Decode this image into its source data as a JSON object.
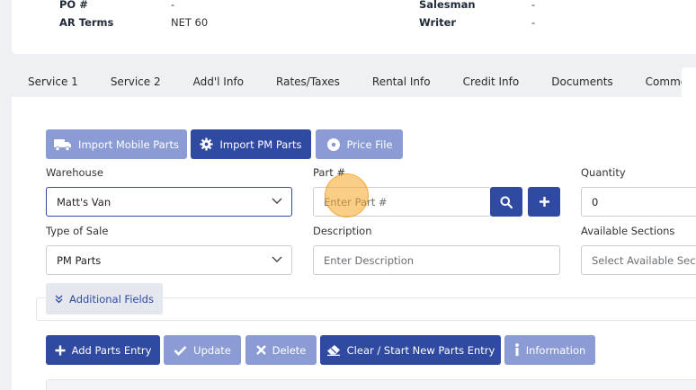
{
  "header": {
    "po_label": "PO #",
    "po_value": "-",
    "ar_terms_label": "AR Terms",
    "ar_terms_value": "NET 60",
    "salesman_label": "Salesman",
    "salesman_value": "-",
    "writer_label": "Writer",
    "writer_value": "-"
  },
  "tabs": [
    "Service 1",
    "Service 2",
    "Add'l Info",
    "Rates/Taxes",
    "Rental Info",
    "Credit Info",
    "Documents",
    "Comments"
  ],
  "import_buttons": {
    "mobile": "Import Mobile Parts",
    "pm": "Import PM Parts",
    "price_file": "Price File"
  },
  "form": {
    "warehouse_label": "Warehouse",
    "warehouse_value": "Matt's Van",
    "part_label": "Part #",
    "part_placeholder": "Enter Part #",
    "quantity_label": "Quantity",
    "quantity_value": "0",
    "type_of_sale_label": "Type of Sale",
    "type_of_sale_value": "PM Parts",
    "description_label": "Description",
    "description_placeholder": "Enter Description",
    "available_sections_label": "Available Sections",
    "available_sections_value": "Select Available Sections"
  },
  "additional_fields": "Additional Fields",
  "actions": {
    "add": "Add Parts Entry",
    "update": "Update",
    "delete": "Delete",
    "clear": "Clear / Start New Parts Entry",
    "information": "Information"
  },
  "colors": {
    "primary": "#2f4aa0",
    "primary_light": "#8b9bd4",
    "highlight": "#f5a623"
  }
}
